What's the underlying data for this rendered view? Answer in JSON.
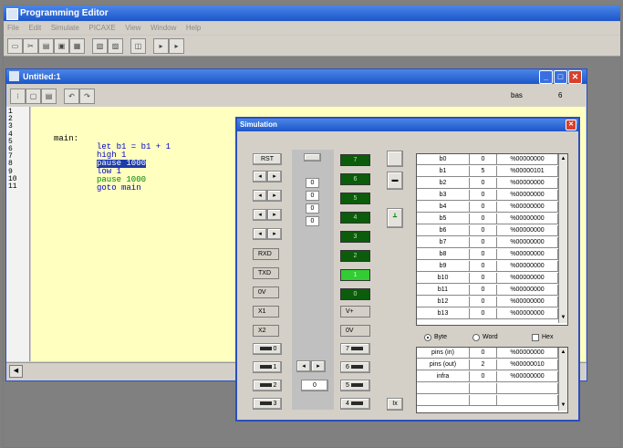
{
  "app": {
    "title": "Programming Editor",
    "menu": [
      "File",
      "Edit",
      "Simulate",
      "PICAXE",
      "View",
      "Window",
      "Help"
    ]
  },
  "editor": {
    "title": "Untitled:1",
    "mode_label": "bas",
    "mode_value": "6",
    "line_numbers": [
      "1",
      "2",
      "3",
      "4",
      "5",
      "6",
      "7",
      "8",
      "9",
      "10",
      "11"
    ],
    "code": {
      "label": "main:",
      "line1": "let b1 = b1 + 1",
      "line2": "high 1",
      "line3": "pause 1000",
      "line4": "low 1",
      "line5": "pause 1000",
      "line6": "goto main"
    }
  },
  "simulation": {
    "title": "Simulation",
    "rst_label": "RST",
    "top_indicator": "",
    "left_buttons": [
      "RXD",
      "TXD",
      "0V",
      "X1",
      "X2"
    ],
    "inputs": [
      "0",
      "1",
      "2",
      "3"
    ],
    "outputs": [
      "7",
      "6",
      "5",
      "4"
    ],
    "output_leds": [
      "7",
      "6",
      "5",
      "4",
      "3",
      "2",
      "1",
      "0"
    ],
    "output_led_on": 1,
    "adc_values": [
      "0",
      "0",
      "0",
      "0"
    ],
    "bottom_value": "0",
    "right_labels": [
      "V+",
      "0V"
    ],
    "variables": [
      {
        "name": "b0",
        "dec": "0",
        "bin": "%00000000"
      },
      {
        "name": "b1",
        "dec": "5",
        "bin": "%00000101"
      },
      {
        "name": "b2",
        "dec": "0",
        "bin": "%00000000"
      },
      {
        "name": "b3",
        "dec": "0",
        "bin": "%00000000"
      },
      {
        "name": "b4",
        "dec": "0",
        "bin": "%00000000"
      },
      {
        "name": "b5",
        "dec": "0",
        "bin": "%00000000"
      },
      {
        "name": "b6",
        "dec": "0",
        "bin": "%00000000"
      },
      {
        "name": "b7",
        "dec": "0",
        "bin": "%00000000"
      },
      {
        "name": "b8",
        "dec": "0",
        "bin": "%00000000"
      },
      {
        "name": "b9",
        "dec": "0",
        "bin": "%00000000"
      },
      {
        "name": "b10",
        "dec": "0",
        "bin": "%00000000"
      },
      {
        "name": "b11",
        "dec": "0",
        "bin": "%00000000"
      },
      {
        "name": "b12",
        "dec": "0",
        "bin": "%00000000"
      },
      {
        "name": "b13",
        "dec": "0",
        "bin": "%00000000"
      }
    ],
    "display_modes": {
      "byte": "Byte",
      "word": "Word",
      "hex": "Hex",
      "selected": "byte"
    },
    "pins": [
      {
        "name": "pins (in)",
        "dec": "0",
        "bin": "%00000000"
      },
      {
        "name": "pins (out)",
        "dec": "2",
        "bin": "%00000010"
      },
      {
        "name": "infra",
        "dec": "0",
        "bin": "%00000000"
      }
    ],
    "close_button": "Ix"
  }
}
